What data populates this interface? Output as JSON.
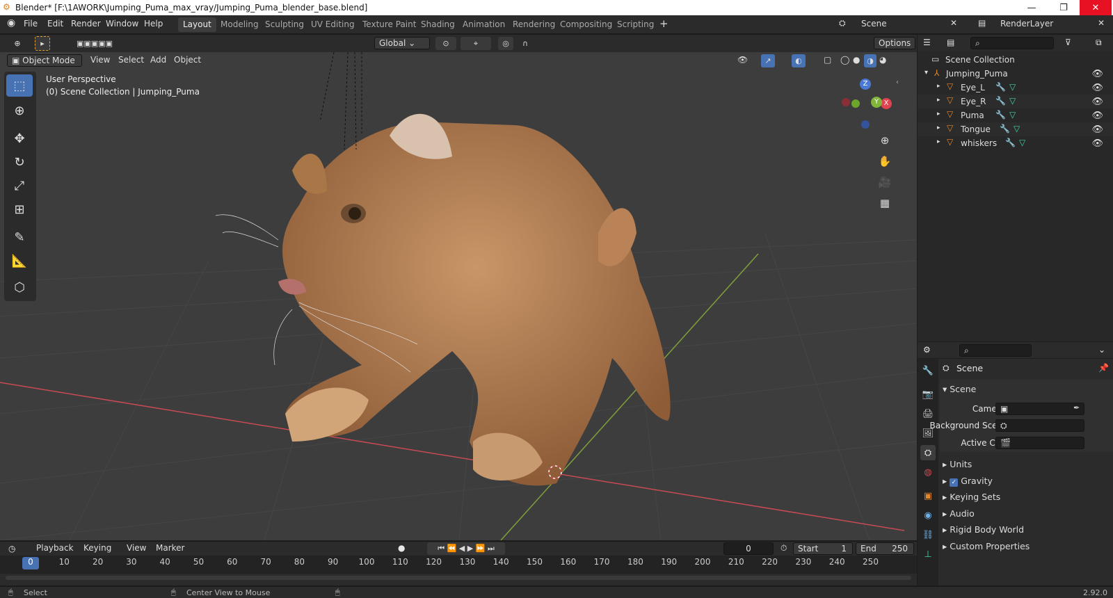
{
  "window": {
    "title": "Blender* [F:\\1AWORK\\Jumping_Puma_max_vray/Jumping_Puma_blender_base.blend]",
    "minimize": "—",
    "restore": "❐",
    "close": "✕"
  },
  "menu": {
    "items": [
      "File",
      "Edit",
      "Render",
      "Window",
      "Help"
    ]
  },
  "workspace_tabs": [
    "Layout",
    "Modeling",
    "Sculpting",
    "UV Editing",
    "Texture Paint",
    "Shading",
    "Animation",
    "Rendering",
    "Compositing",
    "Scripting"
  ],
  "workspace_active": "Layout",
  "scene_field": "Scene",
  "renderlayer_field": "RenderLayer",
  "toolbar": {
    "orientation": "Global",
    "options": "Options"
  },
  "viewport_header": {
    "mode": "Object Mode",
    "menus": [
      "View",
      "Select",
      "Add",
      "Object"
    ]
  },
  "viewport": {
    "perspective": "User Perspective",
    "collection_line": "(0) Scene Collection | Jumping_Puma"
  },
  "gizmo": {
    "z": "Z",
    "y": "Y",
    "x": "X"
  },
  "outliner": {
    "root": "Scene Collection",
    "collection": "Jumping_Puma",
    "objects": [
      "Eye_L",
      "Eye_R",
      "Puma",
      "Tongue",
      "whiskers"
    ]
  },
  "properties": {
    "context": "Scene",
    "panel": "Scene",
    "fields": [
      {
        "label": "Camera"
      },
      {
        "label": "Background Sce..."
      },
      {
        "label": "Active Clip"
      }
    ],
    "sections": [
      "Units",
      "Gravity",
      "Keying Sets",
      "Audio",
      "Rigid Body World",
      "Custom Properties"
    ],
    "gravity_checked": true
  },
  "timeline": {
    "menus": [
      "Playback",
      "Keying",
      "View",
      "Marker"
    ],
    "current_frame": "0",
    "start_label": "Start",
    "start": "1",
    "end_label": "End",
    "end": "250",
    "ticks": [
      "0",
      "10",
      "20",
      "30",
      "40",
      "50",
      "60",
      "70",
      "80",
      "90",
      "100",
      "110",
      "120",
      "130",
      "140",
      "150",
      "160",
      "170",
      "180",
      "190",
      "200",
      "210",
      "220",
      "230",
      "240",
      "250"
    ]
  },
  "status": {
    "left": "Select",
    "middle": "Center View to Mouse",
    "version": "2.92.0"
  },
  "colors": {
    "accent": "#4772b3",
    "xaxis": "#c94a55",
    "yaxis": "#7fa03a",
    "object_icon": "#e5872a"
  }
}
